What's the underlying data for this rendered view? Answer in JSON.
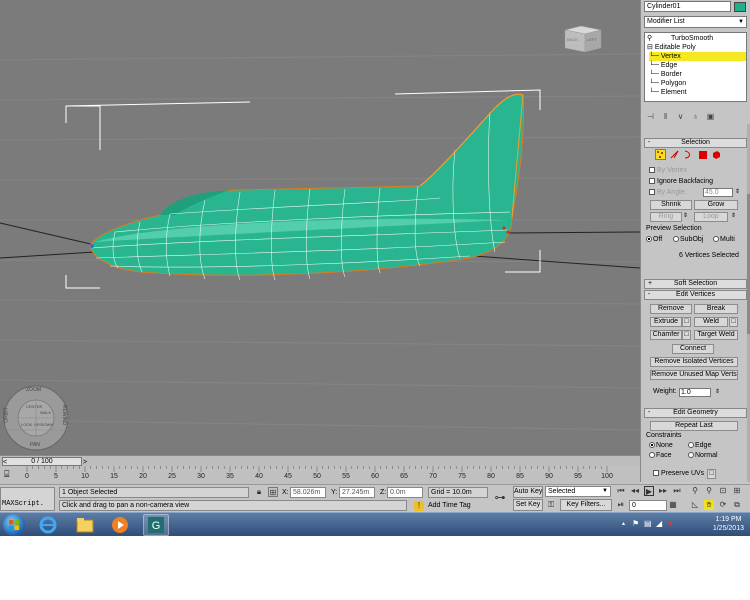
{
  "viewport": {
    "viewcube": {
      "left_label": "BACK",
      "right_label": "LEFT"
    },
    "navwheel": {
      "zoom": "ZOOM",
      "orbit": "ORBIT",
      "pan": "PAN",
      "center": "CENTER",
      "walk": "WALK",
      "rewind": "REWIND",
      "look": "LOOK",
      "updown": "UP/DOWN"
    }
  },
  "command_panel": {
    "object_name": "Cylinder01",
    "object_color": "#20b089",
    "modifier_list": "Modifier List",
    "stack": [
      {
        "label": "TurboSmooth"
      },
      {
        "label": "Editable Poly"
      },
      {
        "label": "Vertex"
      },
      {
        "label": "Edge"
      },
      {
        "label": "Border"
      },
      {
        "label": "Polygon"
      },
      {
        "label": "Element"
      }
    ],
    "selection": {
      "header": "Selection",
      "by_vertex": "By Vertex",
      "ignore_backfacing": "Ignore Backfacing",
      "by_angle": "By Angle:",
      "angle_value": "45.0",
      "shrink": "Shrink",
      "grow": "Grow",
      "ring": "Ring",
      "loop": "Loop",
      "preview_label": "Preview Selection",
      "preview_off": "Off",
      "preview_subobj": "SubObj",
      "preview_multi": "Multi",
      "status": "6 Vertices Selected"
    },
    "soft_selection": {
      "header": "Soft Selection"
    },
    "edit_vertices": {
      "header": "Edit Vertices",
      "remove": "Remove",
      "break": "Break",
      "extrude": "Extrude",
      "weld": "Weld",
      "chamfer": "Chamfer",
      "target_weld": "Target Weld",
      "connect": "Connect",
      "remove_isolated": "Remove Isolated Vertices",
      "remove_unused": "Remove Unused Map Verts",
      "weight_label": "Weight:",
      "weight_value": "1.0"
    },
    "edit_geometry": {
      "header": "Edit Geometry",
      "repeat_last": "Repeat Last",
      "constraints_label": "Constraints",
      "none": "None",
      "edge": "Edge",
      "face": "Face",
      "normal": "Normal",
      "preserve_uvs": "Preserve UVs"
    }
  },
  "timeline": {
    "slider_label": "0 / 100",
    "ticks": [
      "0",
      "5",
      "10",
      "15",
      "20",
      "25",
      "30",
      "35",
      "40",
      "45",
      "50",
      "55",
      "60",
      "65",
      "70",
      "75",
      "80",
      "85",
      "90",
      "95",
      "100"
    ]
  },
  "status": {
    "maxscript": "MAXScript.",
    "object_selected": "1 Object Selected",
    "prompt": "Click and drag to pan a non-camera view",
    "x_label": "X:",
    "x_value": "58.026m",
    "y_label": "Y:",
    "y_value": "27.245m",
    "z_label": "Z:",
    "z_value": "0.0m",
    "grid": "Grid = 10.0m",
    "add_time_tag": "Add Time Tag",
    "auto_key": "Auto Key",
    "set_key": "Set Key",
    "key_mode": "Selected",
    "key_filters": "Key Filters...",
    "frame": "0"
  },
  "taskbar": {
    "time": "1:19 PM",
    "date": "1/25/2013"
  }
}
